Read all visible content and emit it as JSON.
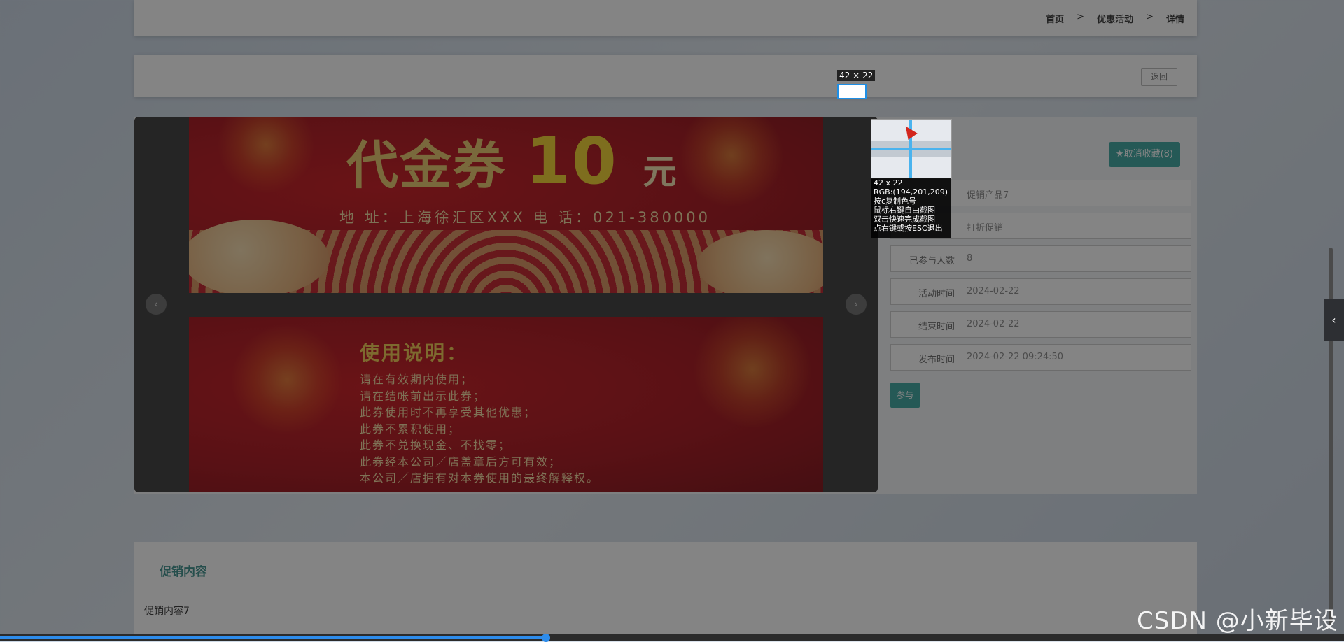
{
  "breadcrumb": {
    "home": "首页",
    "sep": ">",
    "section": "优惠活动",
    "current": "详情"
  },
  "back_button": "返回",
  "gallery": {
    "banner1": {
      "title": "代金券",
      "amount": "10",
      "unit": "元",
      "address": "地 址：上海徐汇区XXX  电 话：021-380000"
    },
    "banner2": {
      "title": "使用说明：",
      "lines": [
        "请在有效期内使用；",
        "请在结帐前出示此券；",
        "此券使用时不再享受其他优惠；",
        "此券不累积使用；",
        "此券不兑换现金、不找零；",
        "此券经本公司／店盖章后方可有效；",
        "本公司／店拥有对本券使用的最终解释权。"
      ]
    },
    "prev_arrow": "‹",
    "next_arrow": "›"
  },
  "info": {
    "fav_button": "★取消收藏(8)",
    "rows": [
      {
        "label": "",
        "value": "促销产品7"
      },
      {
        "label": "",
        "value": "打折促销"
      },
      {
        "label": "已参与人数",
        "value": "8"
      },
      {
        "label": "活动时间",
        "value": "2024-02-22"
      },
      {
        "label": "结束时间",
        "value": "2024-02-22"
      },
      {
        "label": "发布时间",
        "value": "2024-02-22 09:24:50"
      }
    ],
    "join_button": "参与"
  },
  "content": {
    "title": "促销内容",
    "body": "促销内容7"
  },
  "screenshot_tool": {
    "size_label": "42 × 22",
    "info_lines": [
      "42 x 22",
      "RGB:(194,201,209)",
      "按c复制色号",
      "鼠标右键自由截图",
      "双击快速完成截图",
      "点右键或按ESC退出"
    ]
  },
  "side_tab_icon": "chevron-left",
  "side_tab_glyph": "‹",
  "progress": 0.406,
  "watermark": "CSDN @小新毕设"
}
